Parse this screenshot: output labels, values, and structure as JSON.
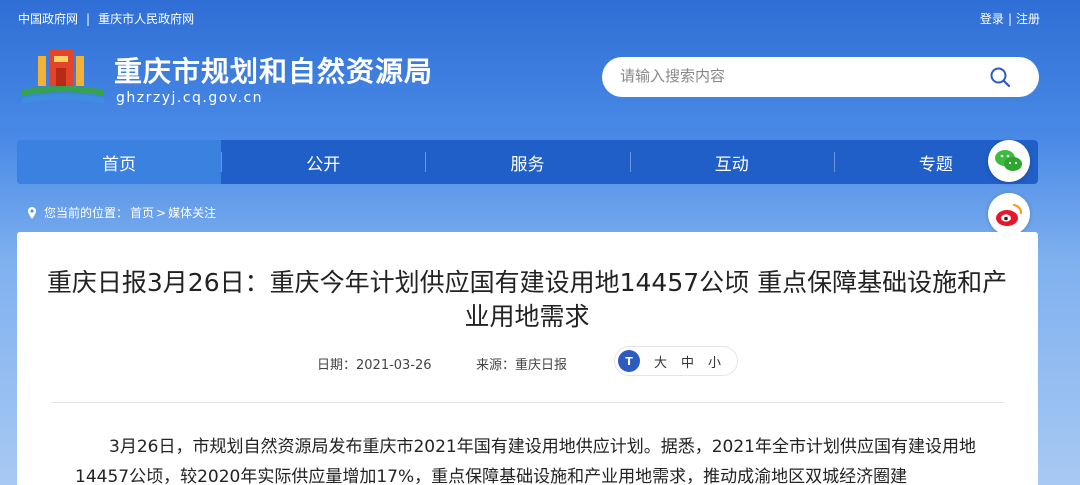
{
  "top_links": {
    "gov": "中国政府网",
    "sep": "|",
    "city_gov": "重庆市人民政府网"
  },
  "auth": {
    "login": "登录",
    "sep": "|",
    "register": "注册"
  },
  "site": {
    "title": "重庆市规划和自然资源局",
    "domain": "ghzrzyj.cq.gov.cn"
  },
  "search": {
    "placeholder": "请输入搜索内容"
  },
  "nav": {
    "items": [
      {
        "label": "首页"
      },
      {
        "label": "公开"
      },
      {
        "label": "服务"
      },
      {
        "label": "互动"
      },
      {
        "label": "专题"
      }
    ]
  },
  "breadcrumb": {
    "prefix": "您当前的位置：",
    "home": "首页",
    "sep": ">",
    "current": "媒体关注"
  },
  "article": {
    "title": "重庆日报3月26日：重庆今年计划供应国有建设用地14457公顷 重点保障基础设施和产业用地需求",
    "date_label": "日期：2021-03-26",
    "source_label": "来源：重庆日报",
    "font_icon": "T",
    "font_sizes": [
      "大",
      "中",
      "小"
    ],
    "body": "3月26日，市规划自然资源局发布重庆市2021年国有建设用地供应计划。据悉，2021年全市计划供应国有建设用地14457公顷，较2020年实际供应量增加17%，重点保障基础设施和产业用地需求，推动成渝地区双城经济圈建"
  },
  "icons": {
    "search": "search-icon",
    "wechat": "wechat-icon",
    "weibo": "weibo-icon",
    "location": "location-pin-icon",
    "logo": "tiananmen-emblem-icon"
  },
  "colors": {
    "nav": "#1f5fc7",
    "nav_active": "#3b82e0",
    "accent": "#2c5bc2"
  }
}
